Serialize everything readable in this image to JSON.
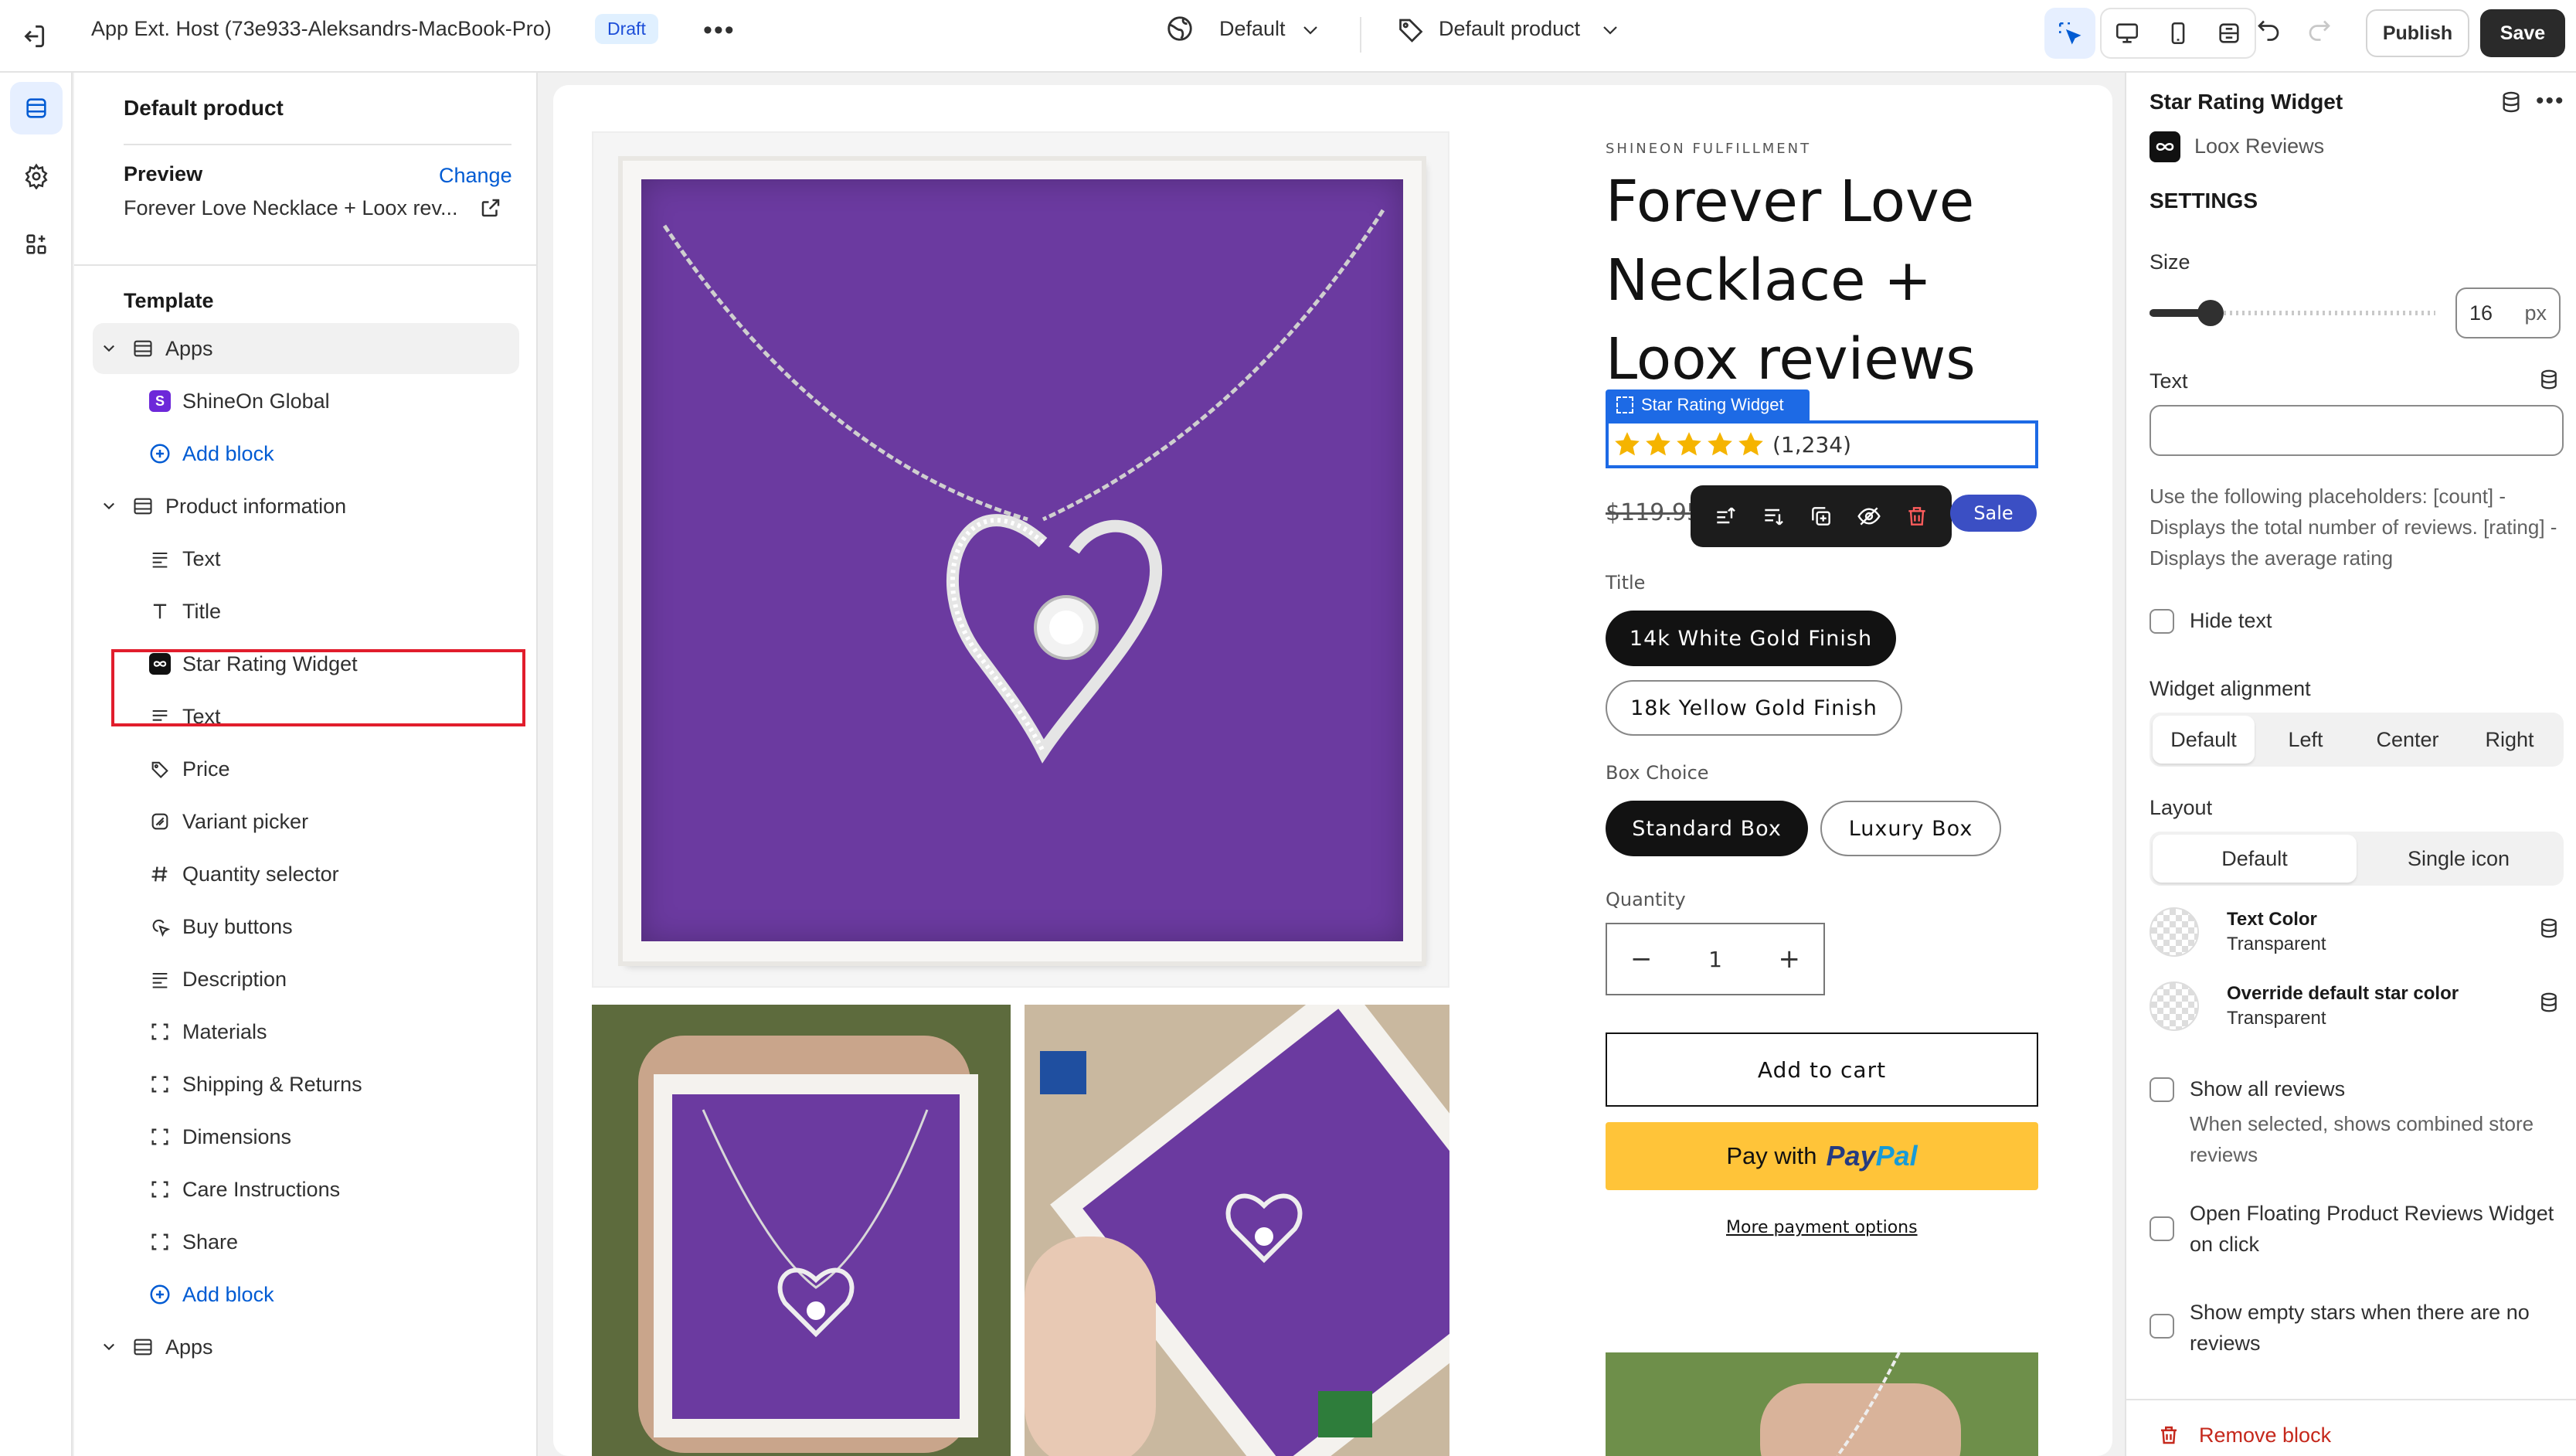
{
  "topbar": {
    "host_title": "App Ext. Host (73e933-Aleksandrs-MacBook-Pro)",
    "status_badge": "Draft",
    "theme_selector": "Default",
    "template_selector": "Default product",
    "publish_label": "Publish",
    "save_label": "Save"
  },
  "left_panel": {
    "heading": "Default product",
    "preview_label": "Preview",
    "change_label": "Change",
    "preview_value": "Forever Love Necklace + Loox rev...",
    "template_label": "Template",
    "tree": [
      {
        "label": "Apps",
        "icon": "section-icon",
        "level": 1
      },
      {
        "label": "ShineOn Global",
        "icon": "app-logo-icon",
        "level": 2
      },
      {
        "label": "Add block",
        "icon": "add-circle-icon",
        "level": 2
      },
      {
        "label": "Product information",
        "icon": "section-icon",
        "level": 1
      },
      {
        "label": "Text",
        "icon": "text-lines-icon",
        "level": 2
      },
      {
        "label": "Title",
        "icon": "title-t-icon",
        "level": 2
      },
      {
        "label": "Star Rating Widget",
        "icon": "loox-logo-icon",
        "level": 2
      },
      {
        "label": "Text",
        "icon": "text-lines-icon",
        "level": 2
      },
      {
        "label": "Price",
        "icon": "price-tag-icon",
        "level": 2
      },
      {
        "label": "Variant picker",
        "icon": "variant-icon",
        "level": 2
      },
      {
        "label": "Quantity selector",
        "icon": "hash-icon",
        "level": 2
      },
      {
        "label": "Buy buttons",
        "icon": "cart-cursor-icon",
        "level": 2
      },
      {
        "label": "Description",
        "icon": "text-lines-icon",
        "level": 2
      },
      {
        "label": "Materials",
        "icon": "dashed-box-icon",
        "level": 2
      },
      {
        "label": "Shipping & Returns",
        "icon": "dashed-box-icon",
        "level": 2
      },
      {
        "label": "Dimensions",
        "icon": "dashed-box-icon",
        "level": 2
      },
      {
        "label": "Care Instructions",
        "icon": "dashed-box-icon",
        "level": 2
      },
      {
        "label": "Share",
        "icon": "dashed-box-icon",
        "level": 2
      },
      {
        "label": "Add block",
        "icon": "add-circle-icon",
        "level": 2
      },
      {
        "label": "Apps",
        "icon": "section-icon",
        "level": 1
      }
    ]
  },
  "product": {
    "vendor": "SHINEON FULFILLMENT",
    "title": "Forever Love Necklace + Loox reviews",
    "widget_tag": "Star Rating Widget",
    "rating_count": "(1,234)",
    "rating": 5,
    "compare_price": "$119.95",
    "sale_badge": "Sale",
    "title_option_label": "Title",
    "title_options": [
      "14k White Gold Finish",
      "18k Yellow Gold Finish"
    ],
    "box_option_label": "Box Choice",
    "box_options": [
      "Standard Box",
      "Luxury Box"
    ],
    "quantity_label": "Quantity",
    "quantity_value": "1",
    "add_to_cart": "Add to cart",
    "paypal_prefix": "Pay with",
    "paypal_brand_a": "Pay",
    "paypal_brand_b": "Pal",
    "more_payment": "More payment options"
  },
  "right_panel": {
    "block_title": "Star Rating Widget",
    "app_name": "Loox Reviews",
    "settings_heading": "SETTINGS",
    "size_label": "Size",
    "size_value": "16",
    "size_unit": "px",
    "text_label": "Text",
    "text_value": "",
    "placeholder_help": "Use the following placeholders: [count] - Displays the total number of reviews. [rating] - Displays the average rating",
    "hide_text": "Hide text",
    "alignment_label": "Widget alignment",
    "alignment_options": [
      "Default",
      "Left",
      "Center",
      "Right"
    ],
    "layout_label": "Layout",
    "layout_options": [
      "Default",
      "Single icon"
    ],
    "text_color_label": "Text Color",
    "text_color_value": "Transparent",
    "star_color_label": "Override default star color",
    "star_color_value": "Transparent",
    "show_all_reviews": "Show all reviews",
    "show_all_help": "When selected, shows combined store reviews",
    "open_floating": "Open Floating Product Reviews Widget on click",
    "show_empty_stars": "Show empty stars when there are no reviews",
    "remove_block": "Remove block"
  },
  "colors": {
    "accent_blue": "#005bd3",
    "selection_red": "#e11d2c",
    "paypal_yellow": "#ffc439",
    "star_gold": "#f5b400",
    "product_purple": "#6b3aa0"
  }
}
